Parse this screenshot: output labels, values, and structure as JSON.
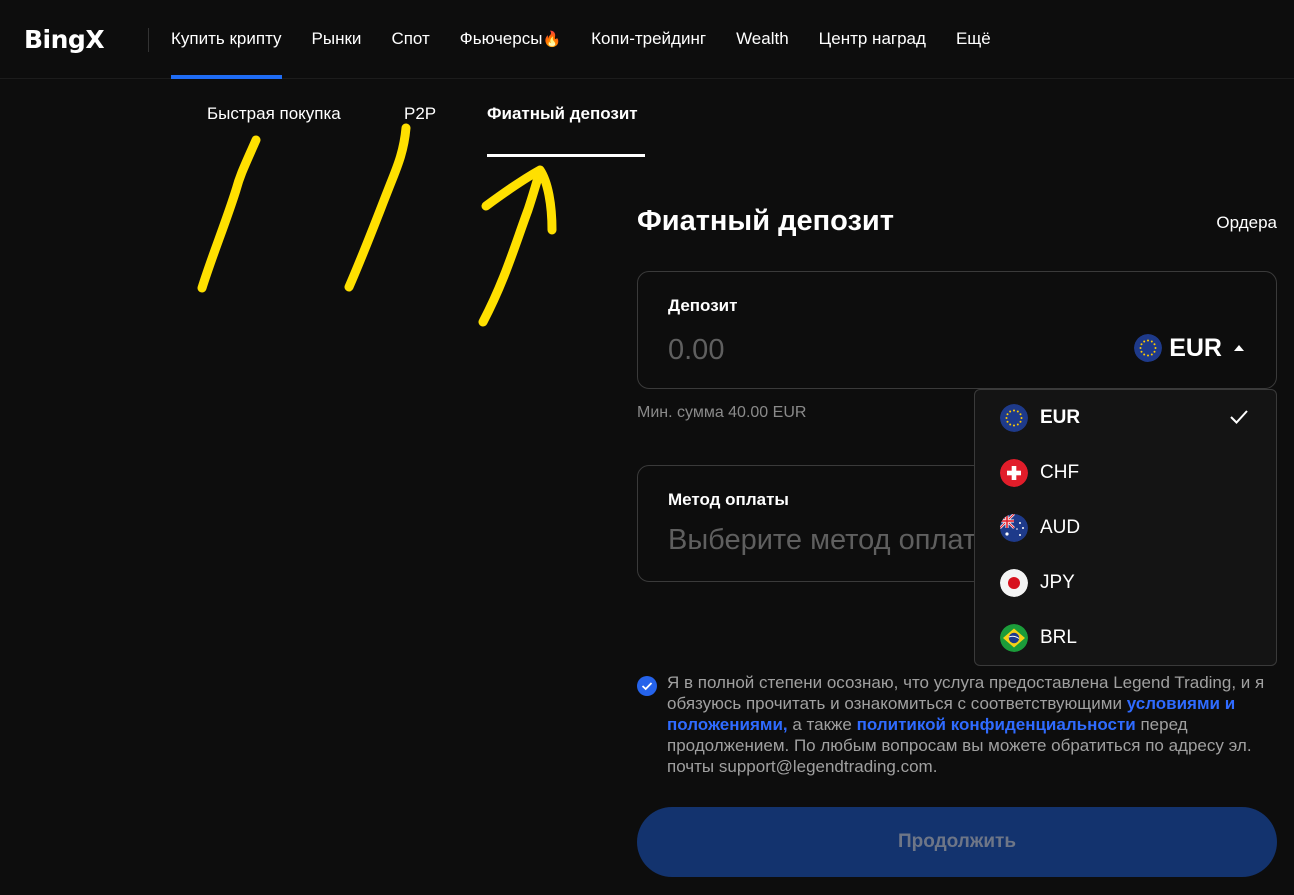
{
  "header": {
    "logo": "BingX",
    "nav": [
      {
        "label": "Купить крипту",
        "active": true
      },
      {
        "label": "Рынки"
      },
      {
        "label": "Спот"
      },
      {
        "label": "Фьючерсы"
      },
      {
        "label": "Копи-трейдинг"
      },
      {
        "label": "Wealth"
      },
      {
        "label": "Центр наград"
      },
      {
        "label": "Ещё"
      }
    ],
    "futures_badge_icon": "fire-icon"
  },
  "subtabs": [
    {
      "label": "Быстрая покупка"
    },
    {
      "label": "P2P"
    },
    {
      "label": "Фиатный депозит",
      "active": true
    }
  ],
  "panel": {
    "title": "Фиатный депозит",
    "orders_link": "Ордера",
    "deposit": {
      "label": "Депозит",
      "placeholder": "0.00",
      "currency": "EUR",
      "min_note": "Мин. сумма 40.00 EUR"
    },
    "method": {
      "label": "Метод оплаты",
      "placeholder": "Выберите метод оплаты"
    }
  },
  "currency_dropdown": {
    "open": true,
    "options": [
      {
        "code": "EUR",
        "flag": "eu-flag-icon",
        "selected": true
      },
      {
        "code": "CHF",
        "flag": "ch-flag-icon"
      },
      {
        "code": "AUD",
        "flag": "au-flag-icon"
      },
      {
        "code": "JPY",
        "flag": "jp-flag-icon"
      },
      {
        "code": "BRL",
        "flag": "br-flag-icon"
      }
    ]
  },
  "agreement": {
    "checked": true,
    "text_before": "Я в полной степени осознаю, что услуга предоставлена Legend Trading, и я обязуюсь прочитать и ознакомиться с соответствующими ",
    "terms_link": "условиями и положениями,",
    "text_middle": " а также ",
    "privacy_link": "политикой конфиденциальности",
    "text_after": " перед продолжением. По любым вопросам вы можете обратиться по адресу эл. почты support@legendtrading.com."
  },
  "continue_button": "Продолжить",
  "colors": {
    "background": "#0d0d0d",
    "accent": "#1f6cf5",
    "link": "#2f6bff",
    "button_disabled": "#13336e",
    "annotation": "#ffe000"
  }
}
